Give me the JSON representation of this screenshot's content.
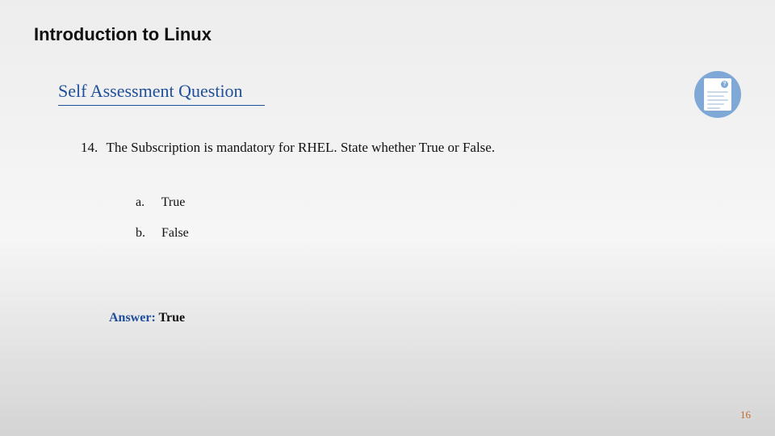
{
  "title": "Introduction to Linux",
  "subtitle": "Self Assessment Question",
  "question": {
    "number": "14.",
    "text": "The Subscription is mandatory for RHEL. State whether True or False."
  },
  "options": [
    {
      "letter": "a.",
      "text": "True"
    },
    {
      "letter": "b.",
      "text": "False"
    }
  ],
  "answer": {
    "label": "Answer: ",
    "value": "True"
  },
  "page_number": "16",
  "badge_q": "?"
}
